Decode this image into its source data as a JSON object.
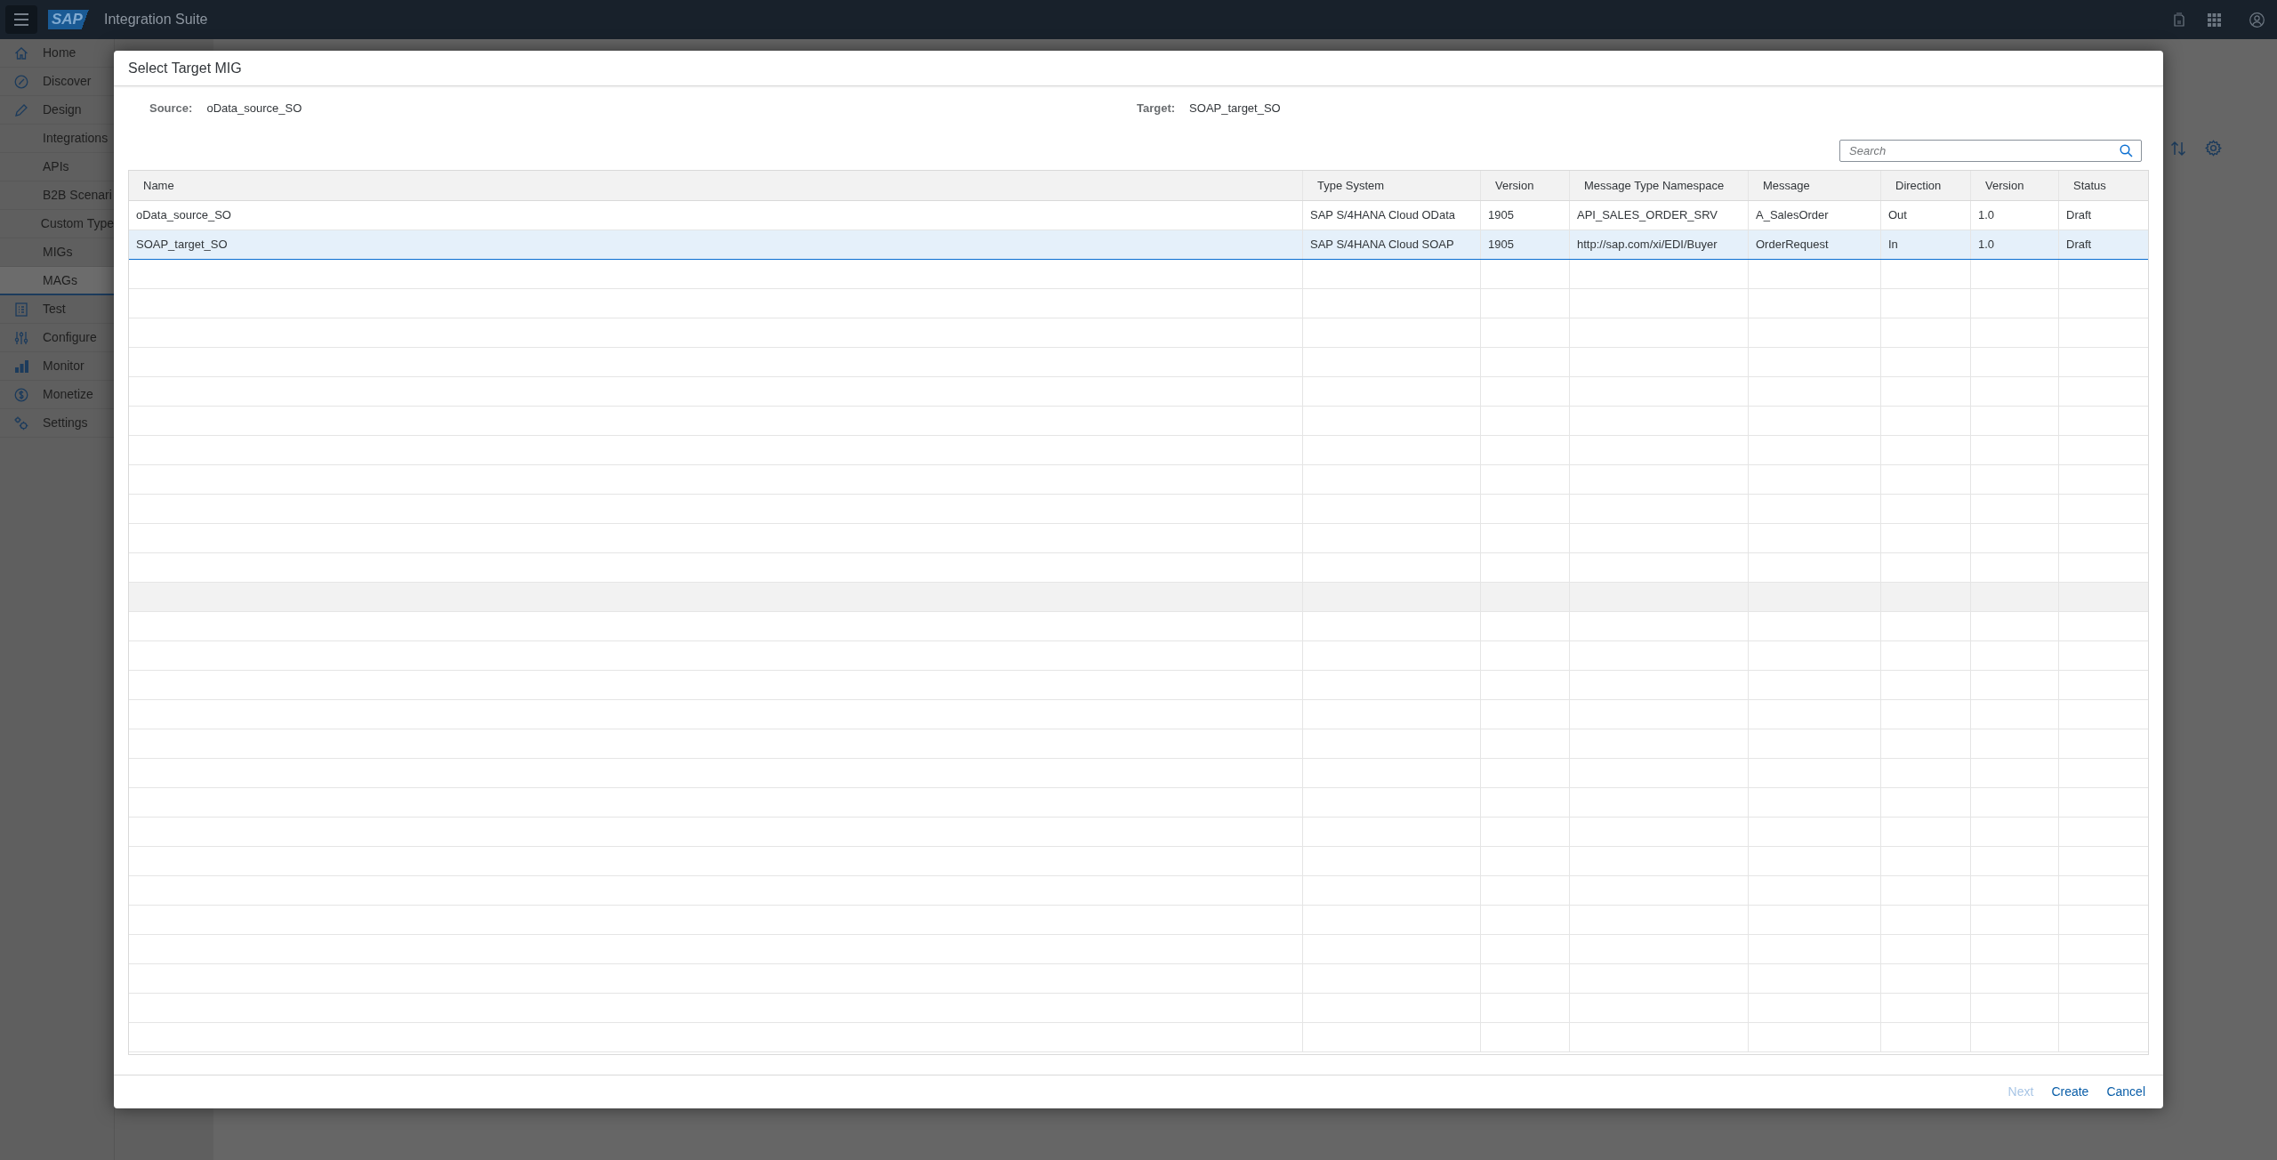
{
  "shell": {
    "logo": "SAP",
    "title": "Integration Suite"
  },
  "sidebar": {
    "items": [
      {
        "label": "Home",
        "kind": "main",
        "selected": false
      },
      {
        "label": "Discover",
        "kind": "main",
        "selected": false
      },
      {
        "label": "Design",
        "kind": "main",
        "selected": false
      },
      {
        "label": "Integrations",
        "kind": "sub",
        "selected": false
      },
      {
        "label": "APIs",
        "kind": "sub",
        "selected": false
      },
      {
        "label": "B2B Scenari",
        "kind": "sub",
        "selected": false
      },
      {
        "label": "Custom Type",
        "kind": "sub",
        "selected": false
      },
      {
        "label": "MIGs",
        "kind": "sub",
        "selected": false
      },
      {
        "label": "MAGs",
        "kind": "sub",
        "selected": true
      },
      {
        "label": "Test",
        "kind": "main",
        "selected": false
      },
      {
        "label": "Configure",
        "kind": "main",
        "selected": false
      },
      {
        "label": "Monitor",
        "kind": "main",
        "selected": false
      },
      {
        "label": "Monetize",
        "kind": "main",
        "selected": false
      },
      {
        "label": "Settings",
        "kind": "main",
        "selected": false
      }
    ]
  },
  "dialog": {
    "title": "Select Target MIG",
    "source": {
      "label": "Source:",
      "value": "oData_source_SO"
    },
    "target": {
      "label": "Target:",
      "value": "SOAP_target_SO"
    },
    "search": {
      "placeholder": "Search"
    },
    "table": {
      "columns": [
        "Name",
        "Type System",
        "Version",
        "Message Type Namespace",
        "Message",
        "Direction",
        "Version",
        "Status"
      ],
      "rows": [
        {
          "cells": [
            "oData_source_SO",
            "SAP S/4HANA Cloud OData",
            "1905",
            "API_SALES_ORDER_SRV",
            "A_SalesOrder",
            "Out",
            "1.0",
            "Draft"
          ],
          "selected": false
        },
        {
          "cells": [
            "SOAP_target_SO",
            "SAP S/4HANA Cloud SOAP",
            "1905",
            "http://sap.com/xi/EDI/Buyer",
            "OrderRequest",
            "In",
            "1.0",
            "Draft"
          ],
          "selected": true
        }
      ]
    },
    "buttons": [
      {
        "label": "Next",
        "disabled": true
      },
      {
        "label": "Create",
        "disabled": false
      },
      {
        "label": "Cancel",
        "disabled": false
      }
    ]
  }
}
